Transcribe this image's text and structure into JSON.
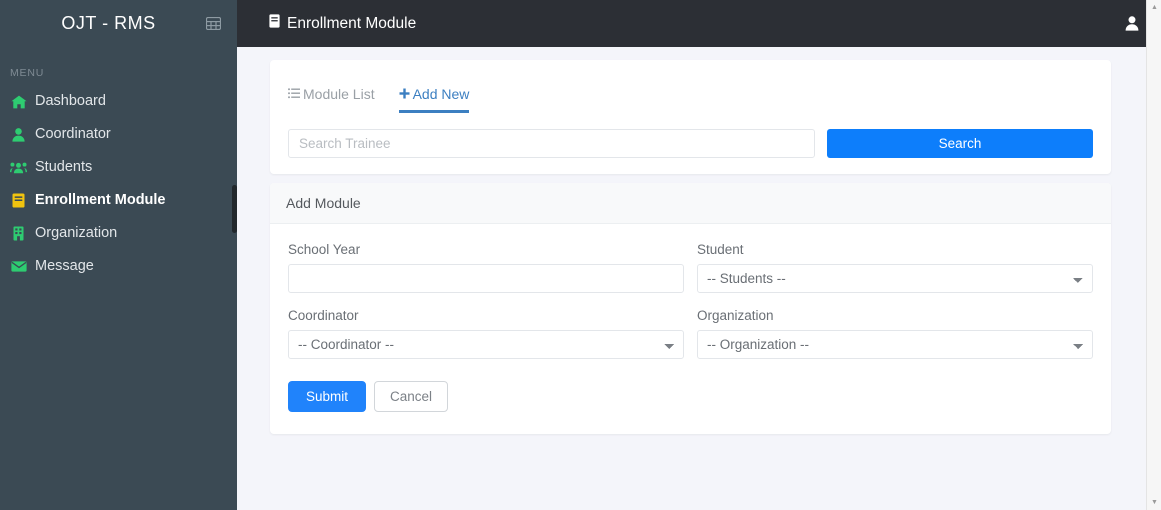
{
  "sidebar": {
    "brand": "OJT - RMS",
    "grid_toggle_icon": "grid-icon",
    "menu_label": "MENU",
    "items": [
      {
        "label": "Dashboard",
        "icon": "home-icon",
        "color": "#2ecc71",
        "active": false
      },
      {
        "label": "Coordinator",
        "icon": "user-icon",
        "color": "#2ecc71",
        "active": false
      },
      {
        "label": "Students",
        "icon": "users-icon",
        "color": "#2ecc71",
        "active": false
      },
      {
        "label": "Enrollment Module",
        "icon": "book-icon",
        "color": "#f1c40f",
        "active": true
      },
      {
        "label": "Organization",
        "icon": "building-icon",
        "color": "#2ecc71",
        "active": false
      },
      {
        "label": "Message",
        "icon": "envelope-icon",
        "color": "#2ecc71",
        "active": false
      }
    ],
    "bg_color": "#3b4a54"
  },
  "topbar": {
    "title": "Enrollment Module",
    "title_icon": "book-icon",
    "user_icon": "user-icon",
    "bg_color": "#2c2f35"
  },
  "tabs": [
    {
      "label": "Module List",
      "icon": "list-icon",
      "active": false
    },
    {
      "label": "Add New",
      "icon": "plus-icon",
      "active": true
    }
  ],
  "search": {
    "placeholder": "Search Trainee",
    "value": "",
    "button_label": "Search",
    "button_color": "#0d7efb"
  },
  "panel": {
    "title": "Add Module",
    "fields": {
      "school_year": {
        "label": "School Year",
        "type": "text",
        "value": "",
        "placeholder": ""
      },
      "student": {
        "label": "Student",
        "type": "select",
        "selected": "-- Students --"
      },
      "coordinator": {
        "label": "Coordinator",
        "type": "select",
        "selected": "-- Coordinator --"
      },
      "organization": {
        "label": "Organization",
        "type": "select",
        "selected": "-- Organization --"
      }
    },
    "buttons": {
      "submit": "Submit",
      "cancel": "Cancel"
    }
  },
  "theme": {
    "page_bg": "#f4f5fa",
    "accent_blue": "#0d7efb",
    "tab_blue": "#3c7fc1"
  }
}
